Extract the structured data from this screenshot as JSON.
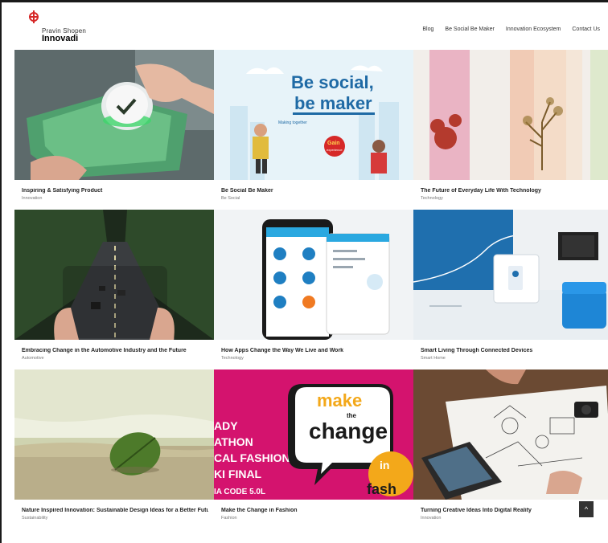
{
  "brand": {
    "line1": "Pravin Shopen",
    "line2": "Innovadi",
    "accent": "#d62828"
  },
  "nav": {
    "items": [
      "Blog",
      "Be Social Be Maker",
      "Innovation Ecosystem",
      "Contact Us"
    ]
  },
  "posts": [
    {
      "title": "Inspiring & Satisfying Product",
      "meta": "Innovation",
      "image": "green-box-button-photo"
    },
    {
      "title": "Be Social Be Maker",
      "meta": "Be Social",
      "image": "be-social-be-maker-illustration",
      "image_text": {
        "heading1": "Be social,",
        "heading2": "be maker",
        "sub": "Making together",
        "badge1": "Gain",
        "badge2": "experience"
      }
    },
    {
      "title": "The Future of Everyday Life With Technology",
      "meta": "Technology",
      "image": "glass-bottles-with-plants-photo"
    },
    {
      "title": "Embracing Change in the Automotive Industry and the Future",
      "meta": "Automotive",
      "image": "road-through-forest-photo"
    },
    {
      "title": "How Apps Change the Way We Live and Work",
      "meta": "Technology",
      "image": "mobile-app-screens"
    },
    {
      "title": "Smart Living Through Connected Devices",
      "meta": "Smart Home",
      "image": "smart-home-device-photo"
    },
    {
      "title": "Nature Inspired Innovation: Sustainable Design Ideas for a Better Future",
      "meta": "Sustainability",
      "image": "leaf-on-beach-photo"
    },
    {
      "title": "Make the Change in Fashion",
      "meta": "Fashion",
      "image": "make-the-change-poster",
      "image_text": {
        "w1": "make",
        "w2": "the",
        "w3": "change",
        "w4": "in",
        "w5": "fash",
        "l1": "ADY",
        "l2": "ATHON",
        "l3": "CAL FASHION",
        "l4": "KI FINAL",
        "l5": "IA CODE 5.0L"
      }
    },
    {
      "title": "Turning Creative Ideas Into Digital Reality",
      "meta": "Innovation",
      "image": "laptop-sketch-desk-photo"
    }
  ],
  "back_to_top": {
    "icon": "arrow-up-icon",
    "glyph": "^"
  }
}
